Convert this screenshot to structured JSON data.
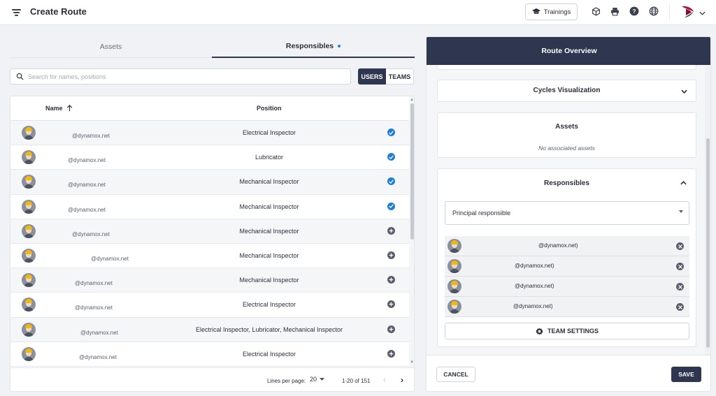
{
  "header": {
    "title": "Create Route",
    "trainings_label": "Trainings",
    "icons": [
      "cube-icon",
      "print-icon",
      "help-icon",
      "globe-icon"
    ]
  },
  "tabs": [
    {
      "label": "Assets",
      "active": false
    },
    {
      "label": "Responsibles",
      "active": true
    }
  ],
  "search": {
    "placeholder": "Search for names, positions",
    "value": ""
  },
  "toggle": {
    "users": "USERS",
    "teams": "TEAMS",
    "selected": "USERS"
  },
  "table": {
    "columns": {
      "name": "Name",
      "position": "Position"
    },
    "rows": [
      {
        "email": "@dynamox.net",
        "position": "Electrical Inspector",
        "selected": true
      },
      {
        "email": "@dynamox.net",
        "position": "Lubricator",
        "selected": true
      },
      {
        "email": "@dynamox.net",
        "position": "Mechanical Inspector",
        "selected": true
      },
      {
        "email": "@dynamox.net",
        "position": "Mechanical Inspector",
        "selected": true
      },
      {
        "email": "@dynamox.net",
        "position": "Mechanical Inspector",
        "selected": false
      },
      {
        "email": "@dynamox.net",
        "position": "Mechanical Inspector",
        "selected": false
      },
      {
        "email": "@dynamox.net",
        "position": "Mechanical Inspector",
        "selected": false
      },
      {
        "email": "@dynamox.net",
        "position": "Electrical Inspector",
        "selected": false
      },
      {
        "email": "@dynamox.net",
        "position": "Electrical Inspector, Lubricator, Mechanical Inspector",
        "selected": false
      },
      {
        "email": "@dynamox.net",
        "position": "Electrical Inspector",
        "selected": false
      }
    ],
    "footer": {
      "lines_per_page_label": "Lines per page:",
      "lines_per_page": "20",
      "range": "1-20 of 151"
    }
  },
  "overview": {
    "title": "Route Overview",
    "cycles_title": "Cycles Visualization",
    "assets_title": "Assets",
    "assets_empty": "No associated assets",
    "responsibles_title": "Responsibles",
    "principal_placeholder": "Principal responsible",
    "responsibles": [
      {
        "email": "@dynamox.net)"
      },
      {
        "email": "@dynamox.net)"
      },
      {
        "email": "@dynamox.net)"
      },
      {
        "email": "@dynamox.net)"
      }
    ],
    "team_settings_label": "TEAM SETTINGS"
  },
  "actions": {
    "cancel": "CANCEL",
    "save": "SAVE"
  },
  "colors": {
    "accent": "#2e3650",
    "check": "#1f7fd6",
    "helmet": "#f1b90f"
  }
}
